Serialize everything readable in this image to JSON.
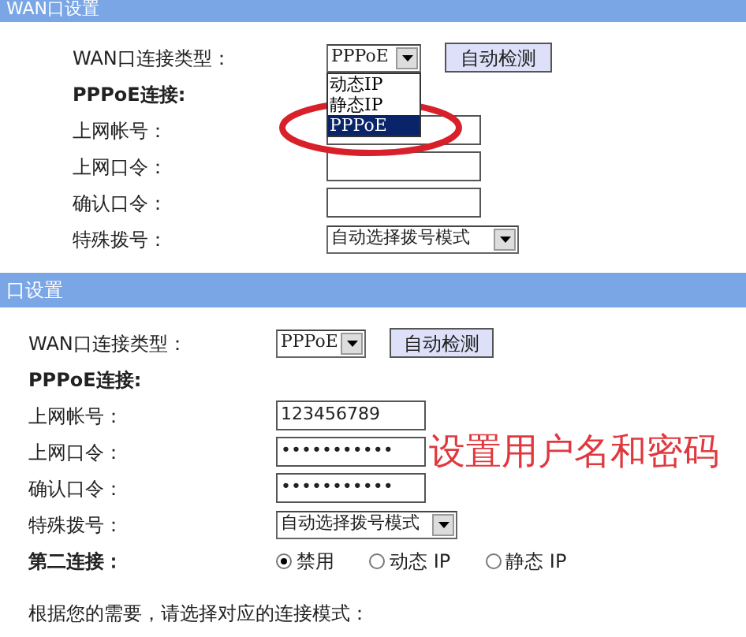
{
  "panels": [
    {
      "title": "WAN口设置",
      "rows": [
        {
          "kind": "select",
          "label": "WAN口连接类型：",
          "value": "PPPoE",
          "button": "自动检测",
          "options": [
            {
              "label": "动态IP",
              "selected": false
            },
            {
              "label": "静态IP",
              "selected": false
            },
            {
              "label": "PPPoE",
              "selected": true
            }
          ]
        },
        {
          "kind": "heading",
          "label": "PPPoE连接:"
        },
        {
          "kind": "text",
          "label": "上网帐号："
        },
        {
          "kind": "text",
          "label": "上网口令："
        },
        {
          "kind": "text",
          "label": "确认口令："
        },
        {
          "kind": "select",
          "label": "特殊拨号：",
          "value": "自动选择拨号模式"
        }
      ]
    },
    {
      "title": "口设置",
      "rows": [
        {
          "kind": "select",
          "label": "WAN口连接类型：",
          "value": "PPPoE",
          "button": "自动检测"
        },
        {
          "kind": "heading",
          "label": "PPPoE连接:"
        },
        {
          "kind": "text",
          "label": "上网帐号：",
          "value": "123456789"
        },
        {
          "kind": "text",
          "label": "上网口令：",
          "value": "•••••••••••",
          "annotation": "设置用户名和密码"
        },
        {
          "kind": "text",
          "label": "确认口令：",
          "value": "•••••••••••"
        },
        {
          "kind": "select",
          "label": "特殊拨号：",
          "value": "自动选择拨号模式"
        },
        {
          "kind": "radio",
          "label": "第二连接：",
          "options": [
            {
              "label": "禁用",
              "selected": true
            },
            {
              "label": "动态 IP",
              "selected": false
            },
            {
              "label": "静态 IP",
              "selected": false
            }
          ]
        },
        {
          "kind": "note",
          "label": "根据您的需要，请选择对应的连接模式："
        }
      ]
    }
  ]
}
